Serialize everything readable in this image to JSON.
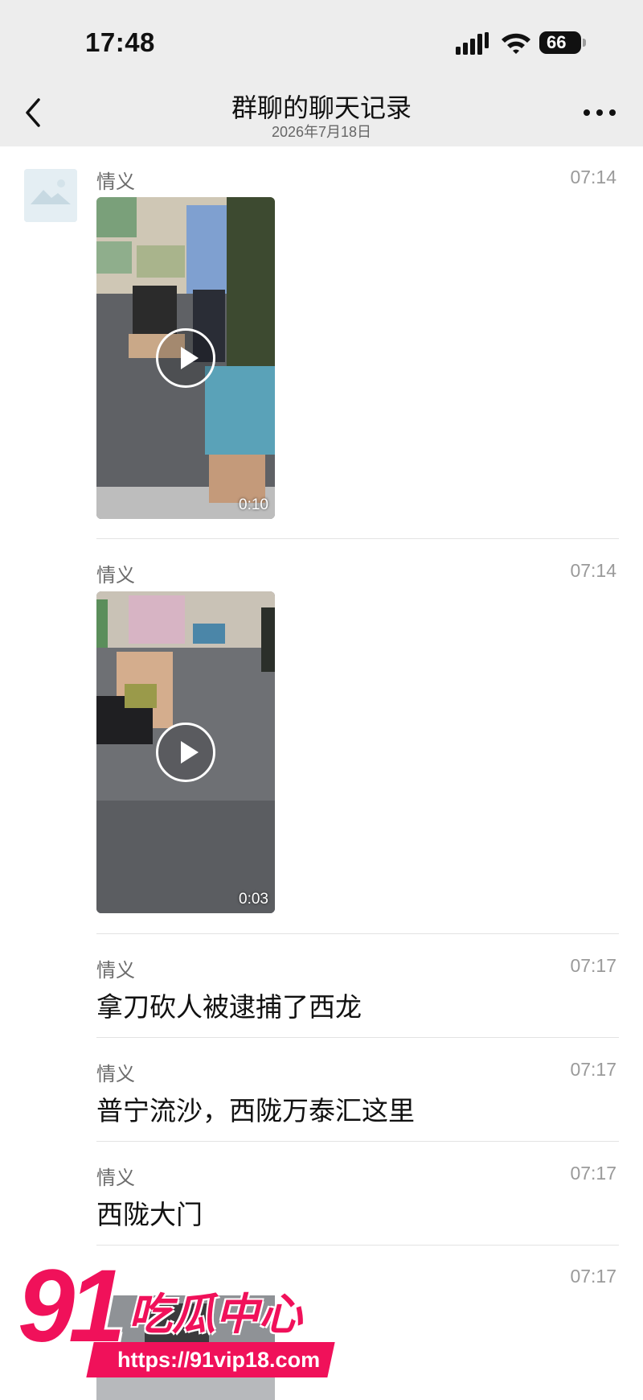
{
  "status_bar": {
    "time": "17:48",
    "battery": "66"
  },
  "nav": {
    "title": "群聊的聊天记录",
    "subtitle": "2026年7月18日"
  },
  "messages": [
    {
      "sender": "情义",
      "time": "07:14",
      "type": "video",
      "duration": "0:10"
    },
    {
      "sender": "情义",
      "time": "07:14",
      "type": "video",
      "duration": "0:03"
    },
    {
      "sender": "情义",
      "time": "07:17",
      "type": "text",
      "text": "拿刀砍人被逮捕了西龙"
    },
    {
      "sender": "情义",
      "time": "07:17",
      "type": "text",
      "text": "普宁流沙，西陇万泰汇这里"
    },
    {
      "sender": "情义",
      "time": "07:17",
      "type": "text",
      "text": "西陇大门"
    },
    {
      "sender": "",
      "time": "07:17",
      "type": "video"
    }
  ],
  "watermark": {
    "number": "91",
    "name": "吃瓜中心",
    "url": "https://91vip18.com"
  },
  "colors": {
    "nav_background": "#ededed",
    "watermark": "#f0115a"
  }
}
